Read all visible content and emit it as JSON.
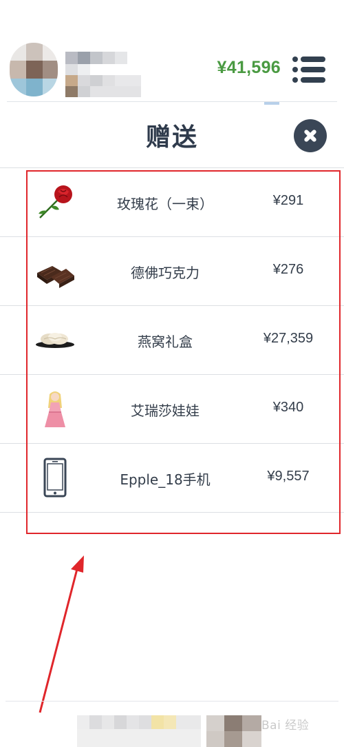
{
  "header": {
    "balance": "¥41,596",
    "menu_icon": "menu-list-icon",
    "avatar_icon": "avatar-pixelated",
    "username_icon": "username-pixelated"
  },
  "dialog": {
    "title": "赠送",
    "close_icon": "close-icon"
  },
  "gifts": [
    {
      "icon": "rose-icon",
      "name": "玫瑰花（一束）",
      "price": "¥291"
    },
    {
      "icon": "chocolate-icon",
      "name": "德佛巧克力",
      "price": "¥276"
    },
    {
      "icon": "birds-nest-giftbox-icon",
      "name": "燕窝礼盒",
      "price": "¥27,359"
    },
    {
      "icon": "doll-icon",
      "name": "艾瑞莎娃娃",
      "price": "¥340"
    },
    {
      "icon": "phone-icon",
      "name": "Epple_18手机",
      "price": "¥9,557"
    }
  ],
  "annotation": {
    "box_color": "#e0262b",
    "arrow_color": "#e0262b"
  },
  "watermark": {
    "text": "Bai 经验",
    "brand_color": "#c9c9c9"
  },
  "colors": {
    "balance": "#4a9a42",
    "dark": "#32404f",
    "text": "#333d4a"
  }
}
